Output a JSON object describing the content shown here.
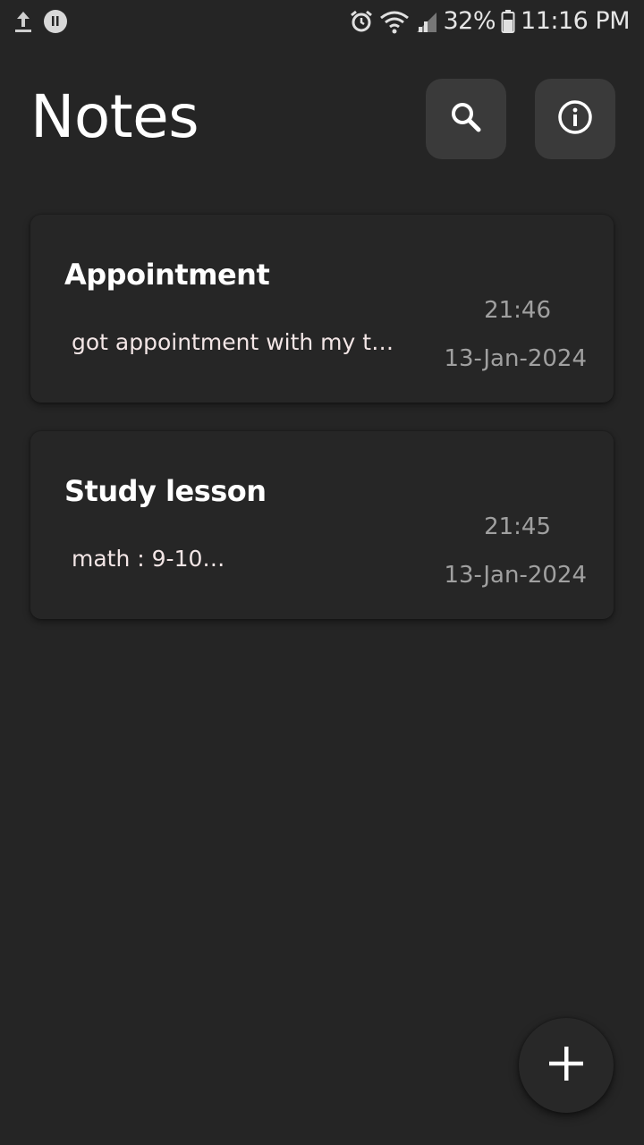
{
  "status_bar": {
    "left_icons": [
      "upload-icon",
      "notification-icon"
    ],
    "right_icons": [
      "alarm-icon",
      "wifi-icon",
      "signal-icon",
      "battery-icon"
    ],
    "battery": "32%",
    "time": "11:16 PM"
  },
  "header": {
    "title": "Notes",
    "search_icon": "search-icon",
    "info_icon": "info-icon"
  },
  "notes": [
    {
      "title": "Appointment",
      "preview": "got appointment with my te…",
      "time": "21:46",
      "date": "13-Jan-2024"
    },
    {
      "title": "Study lesson",
      "preview": "math : 9-10…",
      "time": "21:45",
      "date": "13-Jan-2024"
    }
  ],
  "fab": {
    "icon": "plus-icon"
  },
  "colors": {
    "background": "#252525",
    "card": "#262626",
    "header_button": "#3a3a3a",
    "meta_text": "#a0a0a0",
    "title_text": "#ffffff"
  }
}
